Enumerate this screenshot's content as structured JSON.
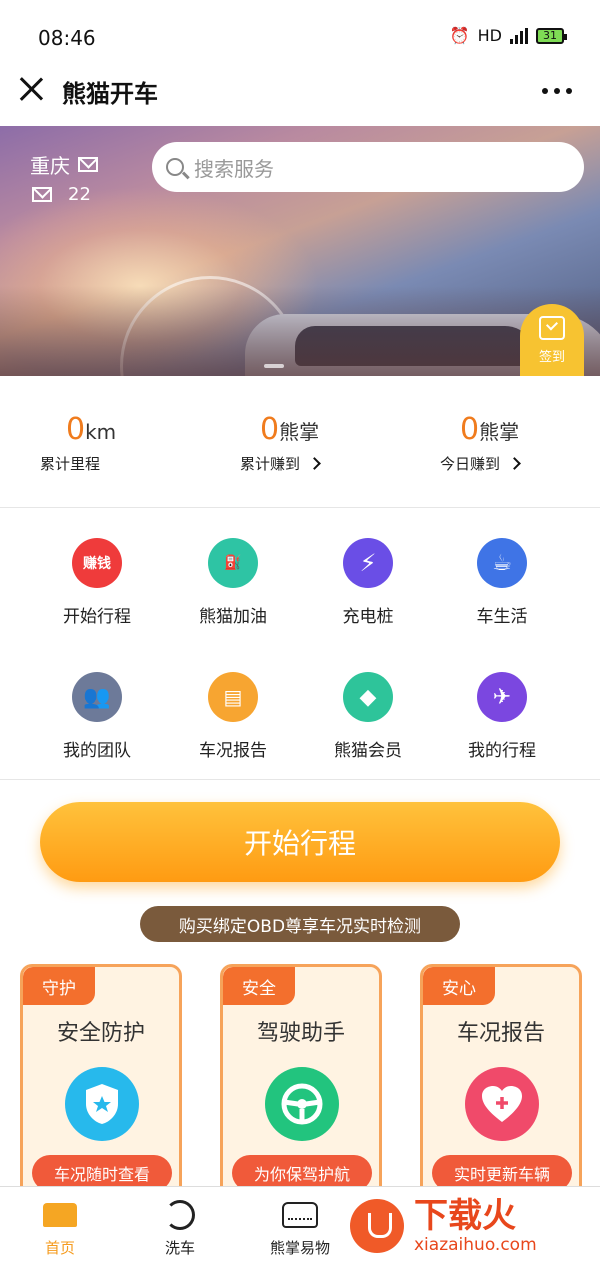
{
  "status_bar": {
    "time": "08:46",
    "network": "HD",
    "signal": "4G",
    "battery": "31"
  },
  "titlebar": {
    "title": "熊猫开车"
  },
  "banner": {
    "city": "重庆",
    "message_count": "22",
    "search_placeholder": "搜索服务",
    "signin_label": "签到"
  },
  "stats": [
    {
      "value": "0",
      "unit": "km",
      "label": "累计里程"
    },
    {
      "value": "0",
      "unit": "熊掌",
      "label": "累计赚到"
    },
    {
      "value": "0",
      "unit": "熊掌",
      "label": "今日赚到"
    }
  ],
  "grid": [
    {
      "label": "开始行程",
      "icon": "earn-money-icon",
      "icon_text": "赚钱",
      "color": "#ef3b3b"
    },
    {
      "label": "熊猫加油",
      "icon": "fuel-pump-icon",
      "color": "#2ec4a4"
    },
    {
      "label": "充电桩",
      "icon": "lightning-icon",
      "color": "#6a4ee6"
    },
    {
      "label": "车生活",
      "icon": "coffee-cup-icon",
      "color": "#3f74e6"
    },
    {
      "label": "我的团队",
      "icon": "team-icon",
      "color": "#6d7a99"
    },
    {
      "label": "车况报告",
      "icon": "report-icon",
      "color": "#f7a531"
    },
    {
      "label": "熊猫会员",
      "icon": "diamond-icon",
      "color": "#2ec49a"
    },
    {
      "label": "我的行程",
      "icon": "airplane-icon",
      "color": "#7b47e0"
    }
  ],
  "start_button": "开始行程",
  "obd_banner": "购买绑定OBD尊享车况实时检测",
  "cards": [
    {
      "tag": "守护",
      "title": "安全防护",
      "pill": "车况随时查看",
      "icon": "shield-icon",
      "color": "#27b9ec"
    },
    {
      "tag": "安全",
      "title": "驾驶助手",
      "pill": "为你保驾护航",
      "icon": "steering-wheel-icon",
      "color": "#22c47e"
    },
    {
      "tag": "安心",
      "title": "车况报告",
      "pill": "实时更新车辆",
      "icon": "heart-plus-icon",
      "color": "#f04a6a"
    }
  ],
  "bottom_nav": [
    {
      "label": "首页",
      "icon": "home-icon",
      "active": true
    },
    {
      "label": "洗车",
      "icon": "car-wash-icon",
      "active": false
    },
    {
      "label": "熊掌易物",
      "icon": "car-shop-icon",
      "active": false
    }
  ],
  "watermark": {
    "title": "下载火",
    "url": "xiazaihuo.com"
  },
  "colors": {
    "accent": "#f59b1e",
    "stat_value": "#f07c1e",
    "card_tag": "#f36f2d",
    "card_pill": "#f05a3a"
  }
}
